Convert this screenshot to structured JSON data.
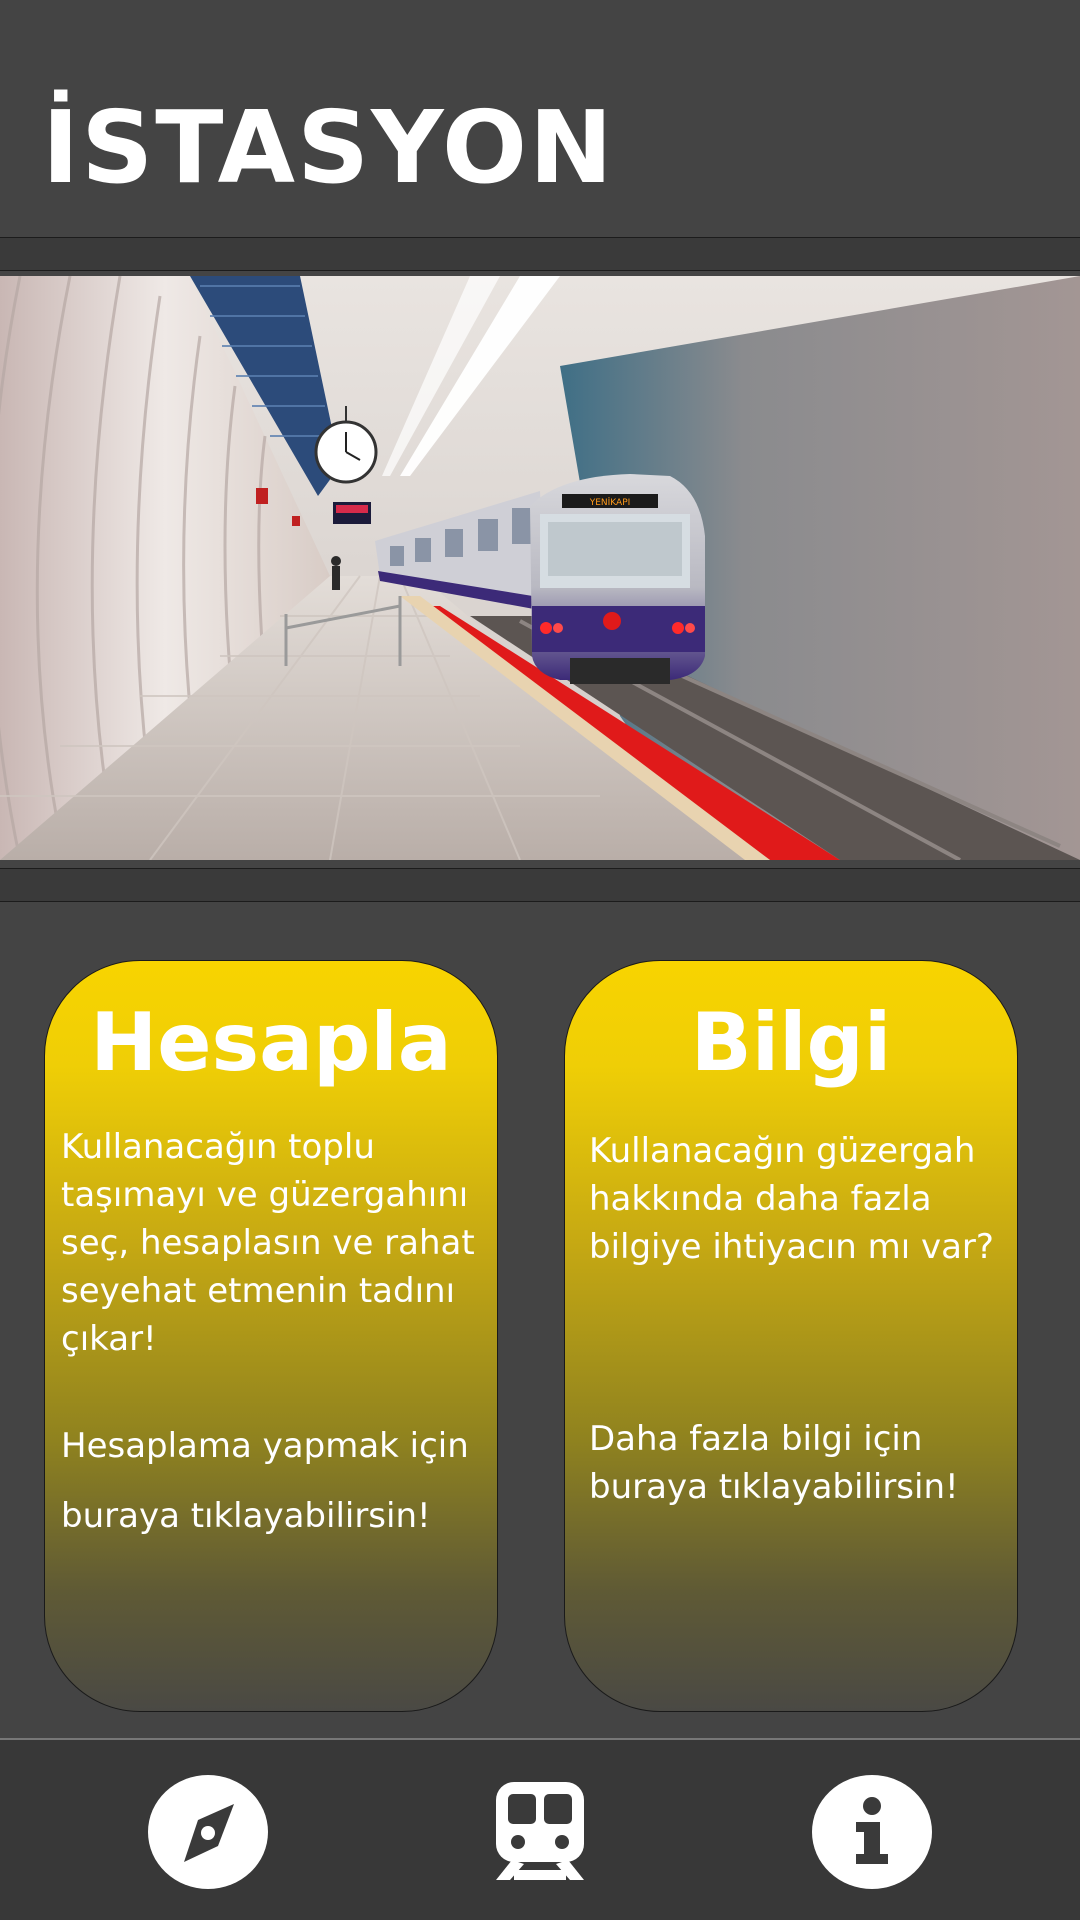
{
  "header": {
    "title": "İSTASYON"
  },
  "hero": {
    "train_destination_sign": "YENİKAPI"
  },
  "cards": {
    "calculate": {
      "title": "Hesapla",
      "description": "Kullanacağın toplu taşımayı ve güzergahını seç, hesaplasın ve rahat seyehat etmenin tadını çıkar!",
      "cta": "Hesaplama yapmak için buraya tıklayabilirsin!"
    },
    "info": {
      "title": "Bilgi",
      "description": "Kullanacağın güzergah hakkında daha fazla bilgiye ihtiyacın mı var?",
      "cta": "Daha fazla bilgi için buraya tıklayabilirsin!"
    }
  },
  "bottom_nav": {
    "items": [
      {
        "icon": "compass-icon"
      },
      {
        "icon": "train-icon"
      },
      {
        "icon": "info-icon"
      }
    ]
  },
  "colors": {
    "background": "#444444",
    "card_gradient_top": "#f8d400",
    "card_gradient_bottom": "#4a4944",
    "text": "#ffffff",
    "accent_red": "#e01a1a"
  }
}
